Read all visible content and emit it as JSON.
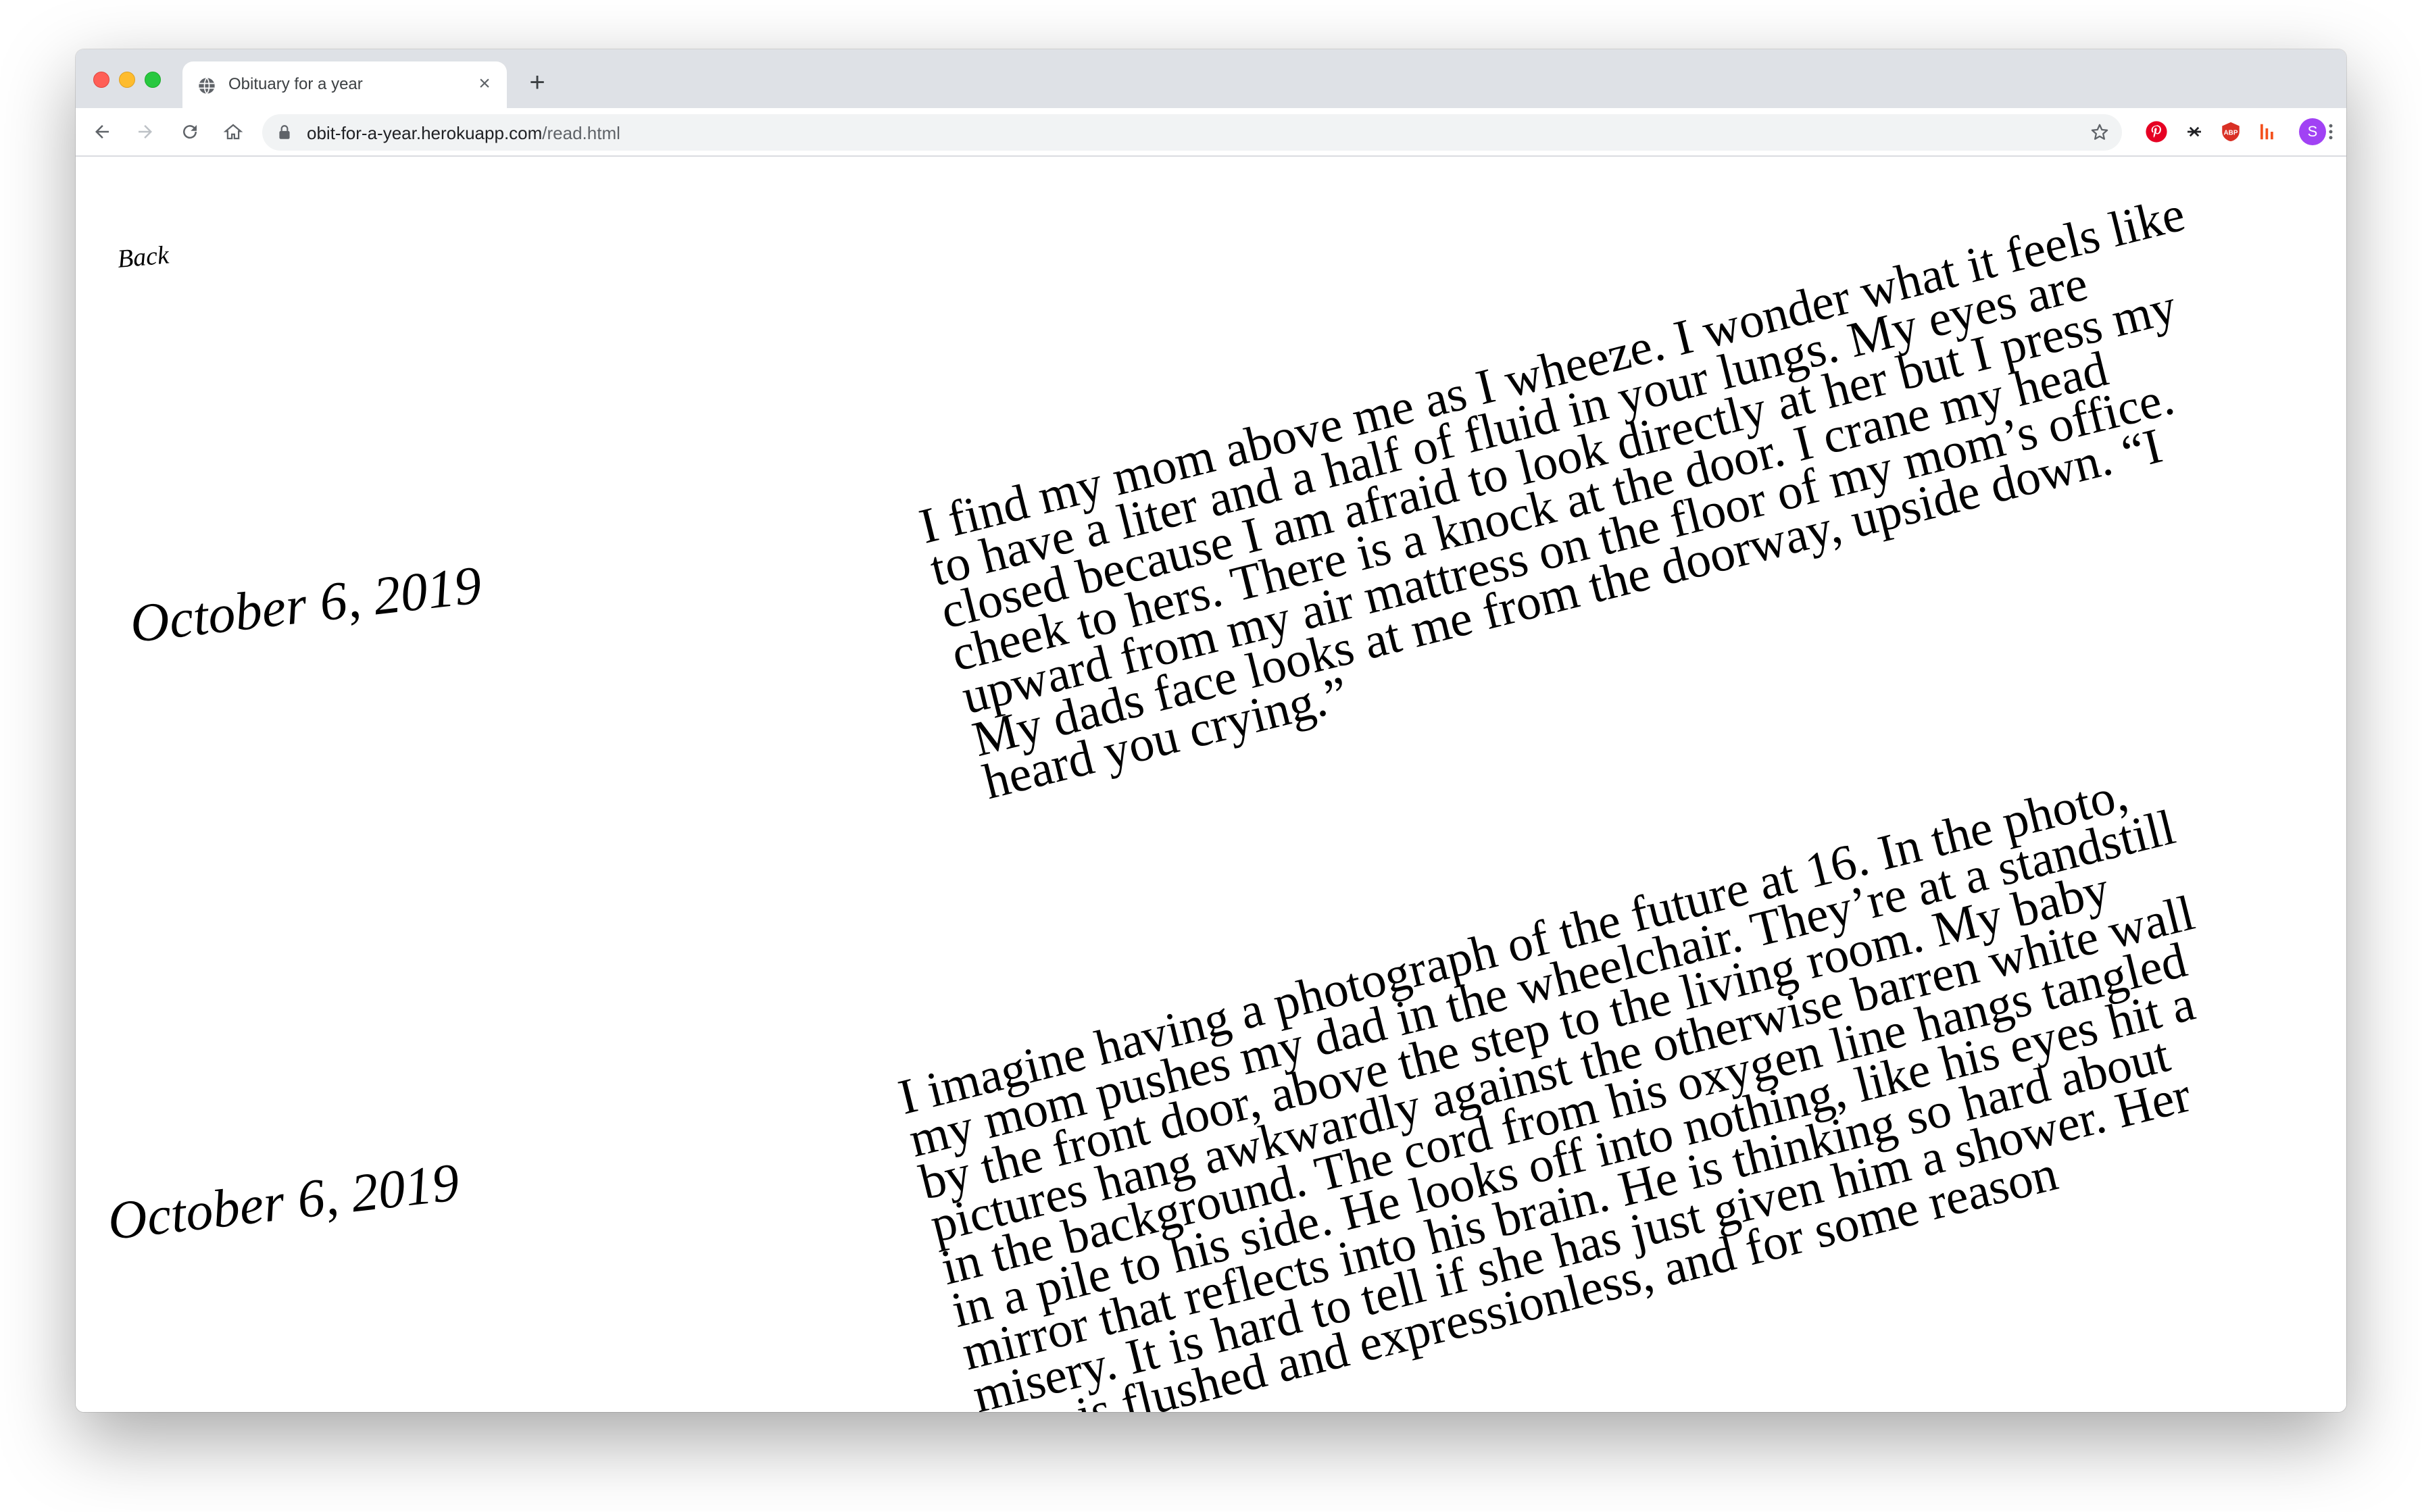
{
  "browser": {
    "tab_title": "Obituary for a year",
    "url_host": "obit-for-a-year.herokuapp.com",
    "url_path": "/read.html",
    "profile_initial": "S",
    "colors": {
      "tabstrip": "#dee1e6",
      "close": "#ff5f57",
      "minimize": "#febc2e",
      "maximize": "#28c840",
      "profile": "#a142f4",
      "pinterest": "#e60023",
      "ext_red": "#d93025",
      "ext_orange": "#f4511e"
    }
  },
  "page": {
    "back_label": "Back",
    "entries": [
      {
        "date": "October 6, 2019",
        "text": "I find my mom above me as I wheeze. I wonder what it feels like to have a liter and a half of fluid in your lungs. My eyes are closed because I am afraid to look directly at her but I press my cheek to hers. There is a knock at the door. I crane my head upward from my air mattress on the floor of my mom’s office. My dads face looks at me from the doorway, upside down. “I heard you crying.”"
      },
      {
        "date": "October 6, 2019",
        "text": "I imagine having a photograph of the future at 16. In the photo, my mom pushes my dad in the wheelchair. They’re at a standstill by the front door, above the step to the living room. My baby pictures hang awkwardly against the otherwise barren white wall in the background. The cord from his oxygen line hangs tangled in a pile to his side. He looks off into nothing, like his eyes hit a mirror that reflects into his brain. He is thinking so hard about misery. It is hard to tell if she has just given him a shower. Her face is flushed and expressionless, and for some reason"
      }
    ]
  }
}
